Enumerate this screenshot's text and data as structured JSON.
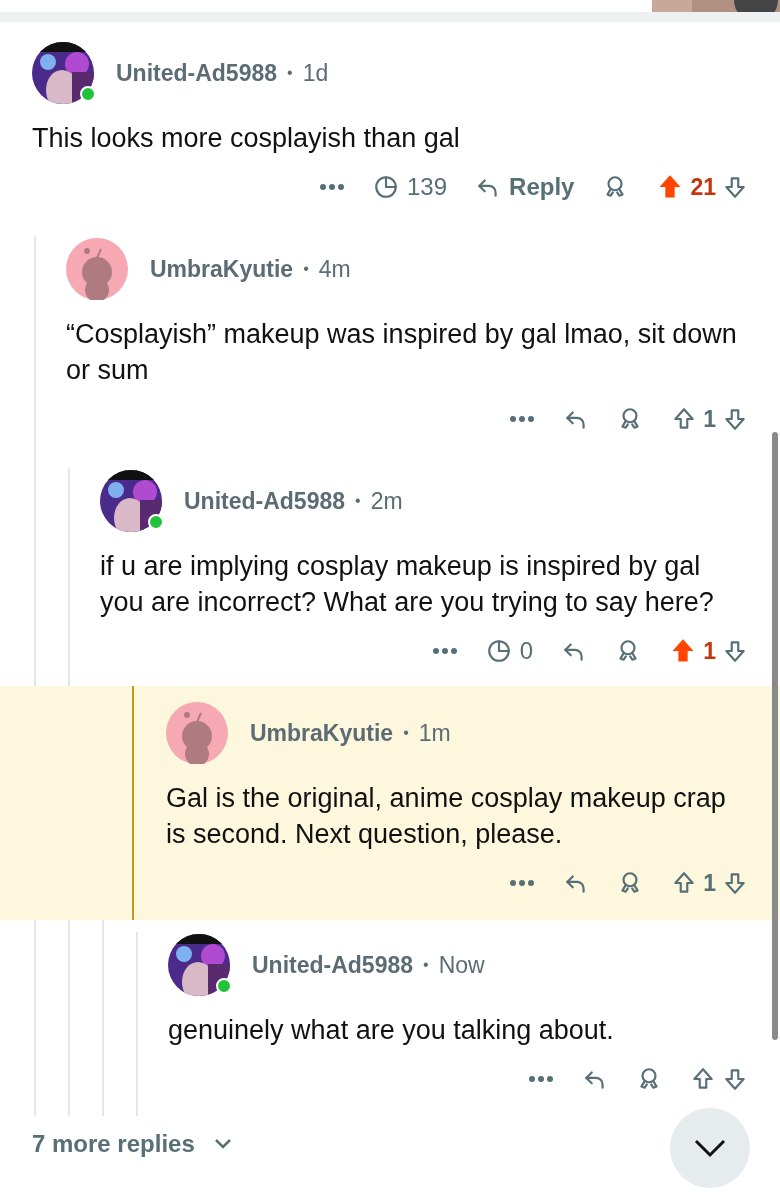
{
  "comments": [
    {
      "author": "United-Ad5988",
      "separator": "•",
      "time": "1d",
      "online": true,
      "body": "This looks more cosplayish than gal",
      "views": "139",
      "reply_label": "Reply",
      "upvoted": true,
      "score": "21",
      "highlighted": false,
      "children": [
        {
          "author": "UmbraKyutie",
          "separator": "•",
          "time": "4m",
          "avatar": {
            "kind": "snoo"
          },
          "online": false,
          "body": "“Cosplayish” makeup was inspired by gal lmao, sit down or sum",
          "upvoted": false,
          "score": "1",
          "highlighted": false,
          "children": [
            {
              "author": "United-Ad5988",
              "separator": "•",
              "time": "2m",
              "online": true,
              "body": "if u are implying cosplay makeup is inspired by gal you are incorrect? What are you trying to say here?",
              "views": "0",
              "upvoted": true,
              "score": "1",
              "highlighted": false,
              "children": [
                {
                  "author": "UmbraKyutie",
                  "separator": "•",
                  "time": "1m",
                  "avatar": {
                    "kind": "snoo"
                  },
                  "online": false,
                  "body": "Gal is the original, anime cosplay makeup crap is second. Next question, please.",
                  "upvoted": false,
                  "score": "1",
                  "highlighted": true,
                  "children": [
                    {
                      "author": "United-Ad5988",
                      "separator": "•",
                      "time": "Now",
                      "online": true,
                      "body": "genuinely what are you talking about.",
                      "upvoted": false,
                      "highlighted": false
                    }
                  ]
                }
              ]
            }
          ]
        }
      ]
    }
  ],
  "more_replies": "7 more replies"
}
